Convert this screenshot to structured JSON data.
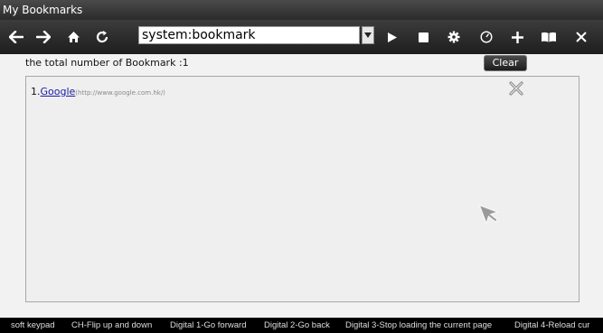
{
  "window": {
    "title": "My Bookmarks"
  },
  "toolbar": {
    "url_value": "system:bookmark",
    "buttons": [
      "back-arrow-icon",
      "forward-arrow-icon",
      "home-icon",
      "refresh-icon",
      "play-icon",
      "stop-icon",
      "gear-icon",
      "clock-icon",
      "plus-icon",
      "book-icon",
      "close-icon"
    ]
  },
  "bookmarks": {
    "count_text": "the total number of Bookmark :1",
    "clear_label": "Clear",
    "items": [
      {
        "index": "1.",
        "title": "Google",
        "url": "(http://www.google.com.hk/)"
      }
    ]
  },
  "statusbar": {
    "items": [
      "soft keypad",
      "CH-Flip up and down",
      "Digital 1-Go forward",
      "Digital 2-Go back",
      "Digital 3-Stop loading the current page",
      "Digital 4-Reload cur"
    ]
  }
}
